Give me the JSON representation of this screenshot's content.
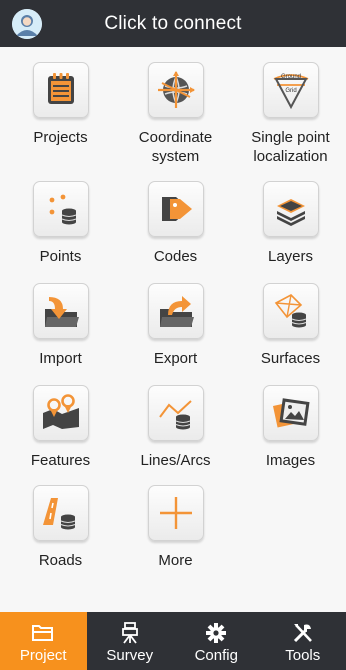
{
  "header": {
    "title": "Click to connect"
  },
  "tiles": [
    {
      "label": "Projects",
      "icon": "projects-icon"
    },
    {
      "label": "Coordinate system",
      "icon": "globe-icon"
    },
    {
      "label": "Single point localization",
      "icon": "ground-grid-icon",
      "badge_top": "Ground",
      "badge_bottom": "Grid"
    },
    {
      "label": "Points",
      "icon": "points-icon"
    },
    {
      "label": "Codes",
      "icon": "tag-icon"
    },
    {
      "label": "Layers",
      "icon": "layers-icon"
    },
    {
      "label": "Import",
      "icon": "import-icon"
    },
    {
      "label": "Export",
      "icon": "export-icon"
    },
    {
      "label": "Surfaces",
      "icon": "surface-icon"
    },
    {
      "label": "Features",
      "icon": "map-pins-icon"
    },
    {
      "label": "Lines/Arcs",
      "icon": "polyline-icon"
    },
    {
      "label": "Images",
      "icon": "image-icon"
    },
    {
      "label": "Roads",
      "icon": "road-icon"
    },
    {
      "label": "More",
      "icon": "plus-icon"
    }
  ],
  "tabs": [
    {
      "label": "Project",
      "icon": "folder-icon",
      "active": true
    },
    {
      "label": "Survey",
      "icon": "survey-instrument-icon",
      "active": false
    },
    {
      "label": "Config",
      "icon": "gear-icon",
      "active": false
    },
    {
      "label": "Tools",
      "icon": "tools-icon",
      "active": false
    }
  ],
  "colors": {
    "accent": "#f7911d",
    "header_bg": "#2f3136",
    "icon_dark": "#444444"
  }
}
